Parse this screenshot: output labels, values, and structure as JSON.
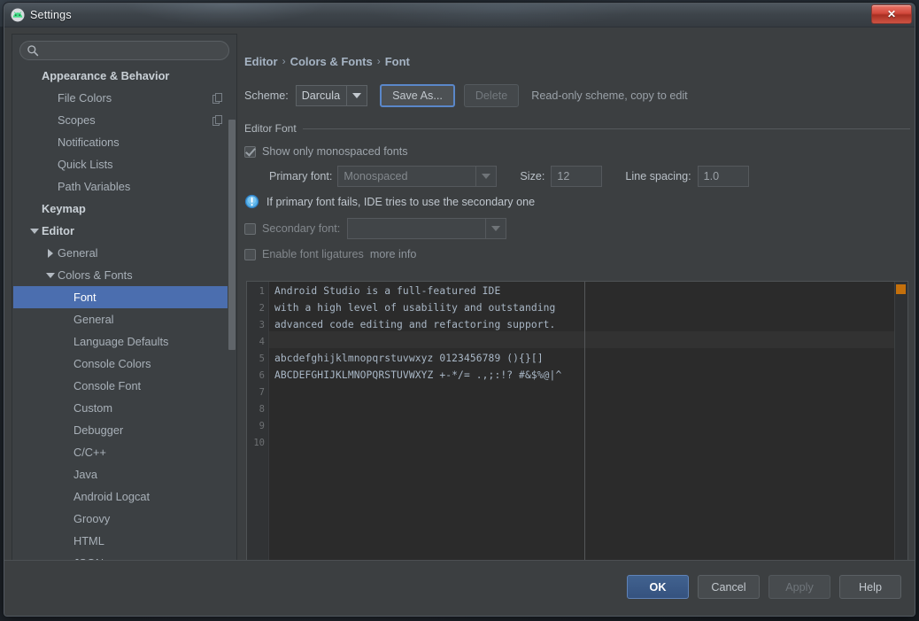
{
  "window": {
    "title": "Settings",
    "app_icon": "android-studio-icon",
    "close_label": "✕"
  },
  "sidebar": {
    "search": {
      "value": "",
      "placeholder": "",
      "icon": "search-icon"
    },
    "items": [
      {
        "label": "Appearance & Behavior",
        "indent": 0,
        "bold": true,
        "twisty": "none",
        "badge": ""
      },
      {
        "label": "File Colors",
        "indent": 1,
        "bold": false,
        "twisty": "none",
        "badge": "copy-icon"
      },
      {
        "label": "Scopes",
        "indent": 1,
        "bold": false,
        "twisty": "none",
        "badge": "copy-icon"
      },
      {
        "label": "Notifications",
        "indent": 1,
        "bold": false,
        "twisty": "none",
        "badge": ""
      },
      {
        "label": "Quick Lists",
        "indent": 1,
        "bold": false,
        "twisty": "none",
        "badge": ""
      },
      {
        "label": "Path Variables",
        "indent": 1,
        "bold": false,
        "twisty": "none",
        "badge": ""
      },
      {
        "label": "Keymap",
        "indent": 0,
        "bold": true,
        "twisty": "none",
        "badge": ""
      },
      {
        "label": "Editor",
        "indent": 0,
        "bold": true,
        "twisty": "down",
        "badge": ""
      },
      {
        "label": "General",
        "indent": 1,
        "bold": false,
        "twisty": "right",
        "badge": ""
      },
      {
        "label": "Colors & Fonts",
        "indent": 1,
        "bold": false,
        "twisty": "down",
        "badge": ""
      },
      {
        "label": "Font",
        "indent": 2,
        "bold": false,
        "twisty": "none",
        "badge": "",
        "selected": true
      },
      {
        "label": "General",
        "indent": 2,
        "bold": false,
        "twisty": "none",
        "badge": ""
      },
      {
        "label": "Language Defaults",
        "indent": 2,
        "bold": false,
        "twisty": "none",
        "badge": ""
      },
      {
        "label": "Console Colors",
        "indent": 2,
        "bold": false,
        "twisty": "none",
        "badge": ""
      },
      {
        "label": "Console Font",
        "indent": 2,
        "bold": false,
        "twisty": "none",
        "badge": ""
      },
      {
        "label": "Custom",
        "indent": 2,
        "bold": false,
        "twisty": "none",
        "badge": ""
      },
      {
        "label": "Debugger",
        "indent": 2,
        "bold": false,
        "twisty": "none",
        "badge": ""
      },
      {
        "label": "C/C++",
        "indent": 2,
        "bold": false,
        "twisty": "none",
        "badge": ""
      },
      {
        "label": "Java",
        "indent": 2,
        "bold": false,
        "twisty": "none",
        "badge": ""
      },
      {
        "label": "Android Logcat",
        "indent": 2,
        "bold": false,
        "twisty": "none",
        "badge": ""
      },
      {
        "label": "Groovy",
        "indent": 2,
        "bold": false,
        "twisty": "none",
        "badge": ""
      },
      {
        "label": "HTML",
        "indent": 2,
        "bold": false,
        "twisty": "none",
        "badge": ""
      },
      {
        "label": "JSON",
        "indent": 2,
        "bold": false,
        "twisty": "none",
        "badge": ""
      }
    ]
  },
  "content": {
    "breadcrumb": [
      "Editor",
      "Colors & Fonts",
      "Font"
    ],
    "breadcrumb_separator": "›",
    "scheme": {
      "label": "Scheme:",
      "value": "Darcula",
      "save_as_label": "Save As...",
      "delete_label": "Delete",
      "readonly_note": "Read-only scheme, copy to edit"
    },
    "editor_font": {
      "group_title": "Editor Font",
      "show_monospaced_label": "Show only monospaced fonts",
      "show_monospaced_checked": true,
      "primary_font_label": "Primary font:",
      "primary_font_value": "Monospaced",
      "size_label": "Size:",
      "size_value": "12",
      "line_spacing_label": "Line spacing:",
      "line_spacing_value": "1.0",
      "info_text": "If primary font fails, IDE tries to use the secondary one",
      "info_icon": "info-icon",
      "secondary_font_label": "Secondary font:",
      "secondary_font_value": "",
      "secondary_font_checked": false,
      "ligatures_label": "Enable font ligatures",
      "ligatures_checked": false,
      "more_info_link": "more info"
    },
    "preview": {
      "lines": [
        {
          "no": "1",
          "text": "Android Studio is a full-featured IDE"
        },
        {
          "no": "2",
          "text": "with a high level of usability and outstanding"
        },
        {
          "no": "3",
          "text": "advanced code editing and refactoring support."
        },
        {
          "no": "4",
          "text": ""
        },
        {
          "no": "5",
          "text": "abcdefghijklmnopqrstuvwxyz 0123456789 (){}[]"
        },
        {
          "no": "6",
          "text": "ABCDEFGHIJKLMNOPQRSTUVWXYZ +-*/= .,;:!? #&$%@|^"
        },
        {
          "no": "7",
          "text": ""
        },
        {
          "no": "8",
          "text": ""
        },
        {
          "no": "9",
          "text": ""
        },
        {
          "no": "10",
          "text": ""
        }
      ],
      "error_marker_color": "#c4700c"
    }
  },
  "footer": {
    "buttons": [
      {
        "label": "OK",
        "style": "primary"
      },
      {
        "label": "Cancel",
        "style": "normal"
      },
      {
        "label": "Apply",
        "style": "disabled"
      },
      {
        "label": "Help",
        "style": "normal"
      }
    ]
  }
}
